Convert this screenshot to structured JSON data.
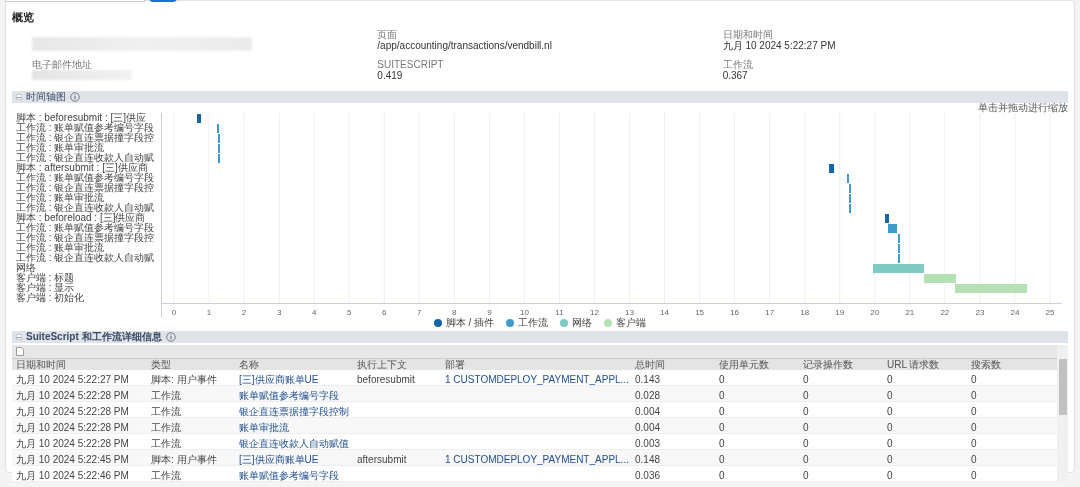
{
  "overview": {
    "title": "概览",
    "columns": [
      [
        {
          "label": "电子邮件地址",
          "redacted": true
        }
      ],
      [
        {
          "label": "页面",
          "value": "/app/accounting/transactions/vendbill.nl"
        },
        {
          "label": "SUITESCRIPT",
          "value": "0.419"
        }
      ],
      [
        {
          "label": "日期和时间",
          "value": "九月 10 2024 5:22:27 PM"
        },
        {
          "label": "工作流",
          "value": "0.367"
        }
      ]
    ]
  },
  "timeline": {
    "title": "时间轴图",
    "zoom_hint": "单击并拖动进行缩放",
    "expanded": true,
    "axis_ticks": [
      "0",
      "1",
      "2",
      "3",
      "4",
      "5",
      "6",
      "7",
      "8",
      "9",
      "10",
      "11",
      "12",
      "13",
      "14",
      "15",
      "16",
      "17",
      "18",
      "19",
      "20",
      "21",
      "22",
      "23",
      "24",
      "25"
    ],
    "legend": [
      {
        "name": "脚本 / 插件",
        "color": "#1565a8"
      },
      {
        "name": "工作流",
        "color": "#3d9cc8"
      },
      {
        "name": "网络",
        "color": "#7ecbc1"
      },
      {
        "name": "客户端",
        "color": "#b5e0b3"
      }
    ],
    "row_labels": [
      "脚本 : beforesubmit : [三]供应",
      "工作流 : 账单赋值参考编号字段",
      "工作流 : 银企直连票据撞字段控",
      "工作流 : 账单审批流",
      "工作流 : 银企直连收款人自动赋",
      "脚本 : aftersubmit : [三]供应商",
      "工作流 : 账单赋值参考编号字段",
      "工作流 : 银企直连票据撞字段控",
      "工作流 : 账单审批流",
      "工作流 : 银企直连收款人自动赋",
      "脚本 : beforeload : [三]供应商",
      "工作流 : 账单赋值参考编号字段",
      "工作流 : 银企直连票据撞字段控",
      "工作流 : 账单审批流",
      "工作流 : 银企直连收款人自动赋",
      "网络",
      "客户端 : 标题",
      "客户端 : 显示",
      "客户端 : 初始化"
    ]
  },
  "details": {
    "title": "SuiteScript 和工作流详细信息",
    "expanded": true,
    "columns": [
      "日期和时间",
      "类型",
      "名称",
      "执行上下文",
      "部署",
      "总时间",
      "使用单元数",
      "记录操作数",
      "URL 请求数",
      "搜索数"
    ],
    "rows": [
      [
        "九月 10 2024 5:22:27 PM",
        "脚本: 用户事件",
        "[三]供应商账单UE",
        "beforesubmit",
        "1 CUSTOMDEPLOY_PAYMENT_APPL...",
        "0.143",
        "0",
        "0",
        "0",
        "0"
      ],
      [
        "九月 10 2024 5:22:28 PM",
        "工作流",
        "账单赋值参考编号字段",
        "",
        "",
        "0.028",
        "0",
        "0",
        "0",
        "0"
      ],
      [
        "九月 10 2024 5:22:28 PM",
        "工作流",
        "银企直连票据撞字段控制",
        "",
        "",
        "0.004",
        "0",
        "0",
        "0",
        "0"
      ],
      [
        "九月 10 2024 5:22:28 PM",
        "工作流",
        "账单审批流",
        "",
        "",
        "0.004",
        "0",
        "0",
        "0",
        "0"
      ],
      [
        "九月 10 2024 5:22:28 PM",
        "工作流",
        "银企直连收款人自动赋值",
        "",
        "",
        "0.003",
        "0",
        "0",
        "0",
        "0"
      ],
      [
        "九月 10 2024 5:22:45 PM",
        "脚本: 用户事件",
        "[三]供应商账单UE",
        "aftersubmit",
        "1 CUSTOMDEPLOY_PAYMENT_APPL...",
        "0.148",
        "0",
        "0",
        "0",
        "0"
      ],
      [
        "九月 10 2024 5:22:46 PM",
        "工作流",
        "账单赋值参考编号字段",
        "",
        "",
        "0.036",
        "0",
        "0",
        "0",
        "0"
      ]
    ]
  }
}
